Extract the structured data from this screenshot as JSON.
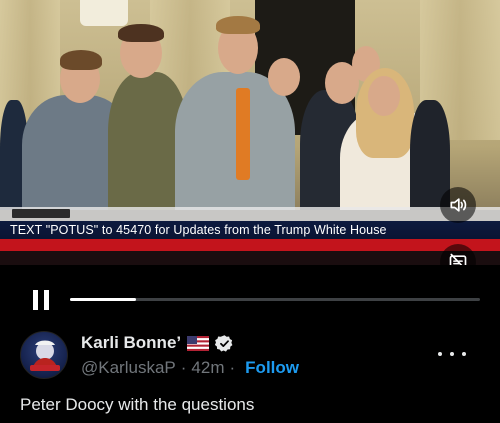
{
  "video": {
    "ticker_text": "TEXT \"POTUS\" to 45470 for Updates from the Trump White House",
    "progress": 0.16
  },
  "controls": {
    "pause_icon": "pause-icon",
    "volume_icon": "speaker-icon",
    "captions_icon": "captions-off-icon"
  },
  "post": {
    "display_name": "Karli Bonne’",
    "handle": "@KarluskaP",
    "time": "42m",
    "separator": "·",
    "follow_label": "Follow",
    "text": "Peter Doocy with the questions",
    "flag_icon": "us-flag-icon",
    "verified_icon": "verified-badge-icon",
    "more_icon": "more-options-icon"
  }
}
